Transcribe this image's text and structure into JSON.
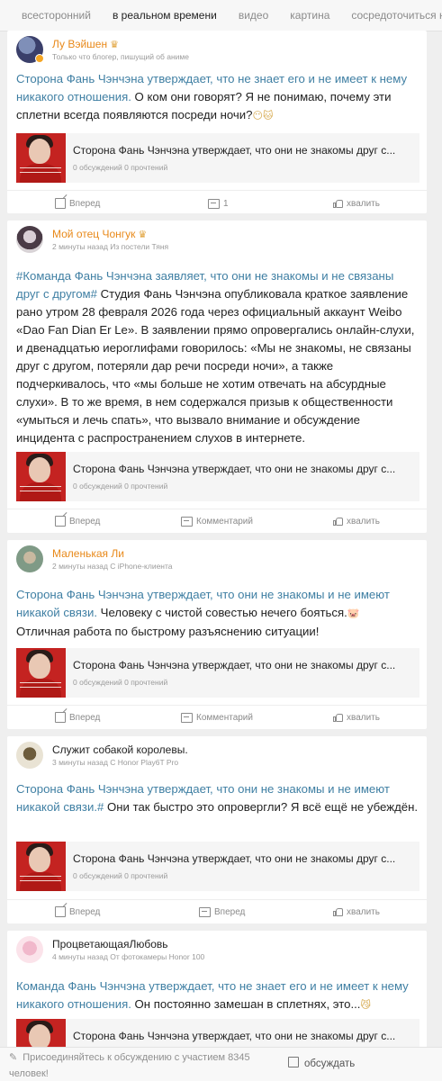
{
  "tabs": [
    "всесторонний",
    "в реальном времени",
    "видео",
    "картина",
    "сосредоточиться н"
  ],
  "active_tab": 1,
  "link_card": {
    "title": "Сторона Фань Чэнчэна утверждает, что они не знакомы друг с...",
    "stats": "0 обсуждений 0 прочтений"
  },
  "posts": [
    {
      "name": "Лу Вэйшен",
      "meta": "Только что блогер, пишущий об аниме",
      "topic": "Сторона Фань Чэнчэна утверждает, что не знает его и не имеет к нему никакого отношения.",
      "text": " О ком они говорят? Я не понимаю, почему эти сплетни всегда появляются посреди ночи?",
      "emoji": "😶🐱",
      "forward": "Вперед",
      "comment": "1",
      "like": "хвалить"
    },
    {
      "name": "Мой отец Чонгук",
      "meta": "2 минуты назад Из постели Тяня",
      "topic": "#Команда Фань Чэнчэна заявляет, что они не знакомы и не связаны друг с другом#",
      "text": " Студия Фань Чэнчэна опубликовала краткое заявление рано утром 28 февраля 2026 года через официальный аккаунт Weibo «Dao Fan Dian Er Le». В заявлении прямо опровергались онлайн-слухи, и двенадцатью иероглифами говорилось: «Мы не знакомы, не связаны друг с другом, потеряли дар речи посреди ночи», а также подчеркивалось, что «мы больше не хотим отвечать на абсурдные слухи». В то же время, в нем содержался призыв к общественности «умыться и лечь спать», что вызвало внимание и обсуждение инцидента с распространением слухов в интернете.",
      "emoji": "",
      "forward": "Вперед",
      "comment": "Комментарий",
      "like": "хвалить"
    },
    {
      "name": "Маленькая Ли",
      "meta": "2 минуты назад С iPhone-клиента",
      "topic": "Сторона Фань Чэнчэна утверждает, что они не знакомы и не имеют никакой связи.",
      "text": " Человеку с чистой совестью нечего бояться.",
      "emoji": "🐷",
      "text2": "Отличная работа по быстрому разъяснению ситуации!",
      "forward": "Вперед",
      "comment": "Комментарий",
      "like": "хвалить"
    },
    {
      "name": "Служит собакой королевы.",
      "meta": "3 минуты назад С Honor Play6T Pro",
      "topic": "Сторона Фань Чэнчэна утверждает, что они не знакомы и не имеют никакой связи.#",
      "text": " Они так быстро это опровергли? Я всё ещё не убеждён.",
      "emoji": "",
      "forward": "Вперед",
      "comment": "Вперед",
      "like": "хвалить"
    },
    {
      "name": "ПроцветающаяЛюбовь",
      "meta": "4 минуты назад От фотокамеры Honor 100",
      "topic": "Команда Фань Чэнчэна утверждает, что не знает его и не имеет к нему никакого отношения.",
      "text": " Он постоянно замешан в сплетнях, это...",
      "emoji": "😼"
    }
  ],
  "bottom": {
    "prompt": "Присоединяйтесь к обсуждению с участием 8345 человек!",
    "discuss": "обсуждать"
  }
}
